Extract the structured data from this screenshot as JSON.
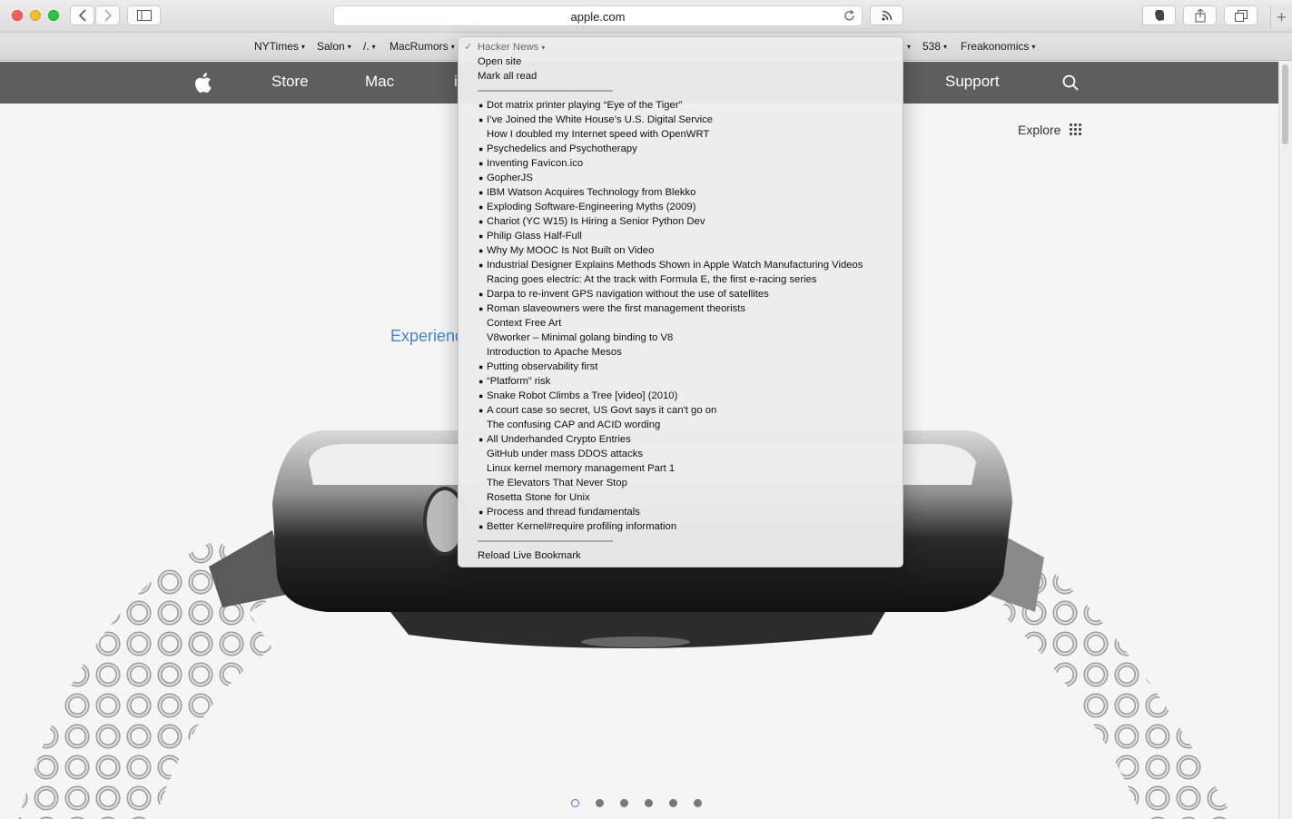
{
  "browser": {
    "url": "apple.com",
    "new_tab_symbol": "+"
  },
  "bookmarks": [
    {
      "label": "NYTimes",
      "arrow": "▾"
    },
    {
      "label": "Salon",
      "arrow": "▾"
    },
    {
      "label": "/.",
      "arrow": "▾"
    },
    {
      "label": "MacRumors",
      "arrow": "▾"
    },
    {
      "label": "",
      "arrow": "▾"
    },
    {
      "label": "538",
      "arrow": "▾"
    },
    {
      "label": "Freakonomics",
      "arrow": "▾"
    }
  ],
  "apple_nav": {
    "store": "Store",
    "mac": "Mac",
    "partial": "i",
    "support": "Support"
  },
  "page": {
    "explore": "Explore",
    "hero_text": "Experienc",
    "carousel_pages": 6,
    "active_page": 1
  },
  "menu": {
    "title": "Hacker News",
    "title_arrow": "▾",
    "checkmark": "✓",
    "open_site": "Open site",
    "mark_all_read": "Mark all read",
    "reload": "Reload Live Bookmark",
    "items": [
      {
        "title": "Dot matrix printer playing “Eye of the Tiger”",
        "unread": true
      },
      {
        "title": "I’ve Joined the White House’s U.S. Digital Service",
        "unread": true
      },
      {
        "title": "How I doubled my Internet speed with OpenWRT",
        "unread": false
      },
      {
        "title": "Psychedelics and Psychotherapy",
        "unread": true
      },
      {
        "title": "Inventing Favicon.ico",
        "unread": true
      },
      {
        "title": "GopherJS",
        "unread": true
      },
      {
        "title": "IBM Watson Acquires Technology from Blekko",
        "unread": true
      },
      {
        "title": "Exploding Software-Engineering Myths (2009)",
        "unread": true
      },
      {
        "title": "Chariot (YC W15) Is Hiring a Senior Python Dev",
        "unread": true
      },
      {
        "title": "Philip Glass Half-Full",
        "unread": true
      },
      {
        "title": "Why My MOOC Is Not Built on Video",
        "unread": true
      },
      {
        "title": "Industrial Designer Explains Methods Shown in Apple Watch Manufacturing Videos",
        "unread": true
      },
      {
        "title": "Racing goes electric: At the track with Formula E, the first e-racing series",
        "unread": false
      },
      {
        "title": "Darpa to re-invent GPS navigation without the use of satellites",
        "unread": true
      },
      {
        "title": "Roman slaveowners were the first management theorists",
        "unread": true
      },
      {
        "title": "Context Free Art",
        "unread": false
      },
      {
        "title": "V8worker – Minimal golang binding to V8",
        "unread": false
      },
      {
        "title": "Introduction to Apache Mesos",
        "unread": false
      },
      {
        "title": "Putting observability first",
        "unread": true
      },
      {
        "title": "“Platform” risk",
        "unread": true
      },
      {
        "title": "Snake Robot Climbs a Tree [video] (2010)",
        "unread": true
      },
      {
        "title": "A court case so secret, US Govt says it can't go on",
        "unread": true
      },
      {
        "title": "The confusing CAP and ACID wording",
        "unread": false
      },
      {
        "title": "All Underhanded Crypto Entries",
        "unread": true
      },
      {
        "title": "GitHub under mass DDOS attacks",
        "unread": false
      },
      {
        "title": "Linux kernel memory management Part 1",
        "unread": false
      },
      {
        "title": "The Elevators That Never Stop",
        "unread": false
      },
      {
        "title": "Rosetta Stone for Unix",
        "unread": false
      },
      {
        "title": "Process and thread fundamentals",
        "unread": true
      },
      {
        "title": "Better Kernel#require profiling information",
        "unread": true
      }
    ]
  },
  "colors": {
    "nav_bg": "#5e5e5e",
    "hero_text": "#3d88d0"
  }
}
